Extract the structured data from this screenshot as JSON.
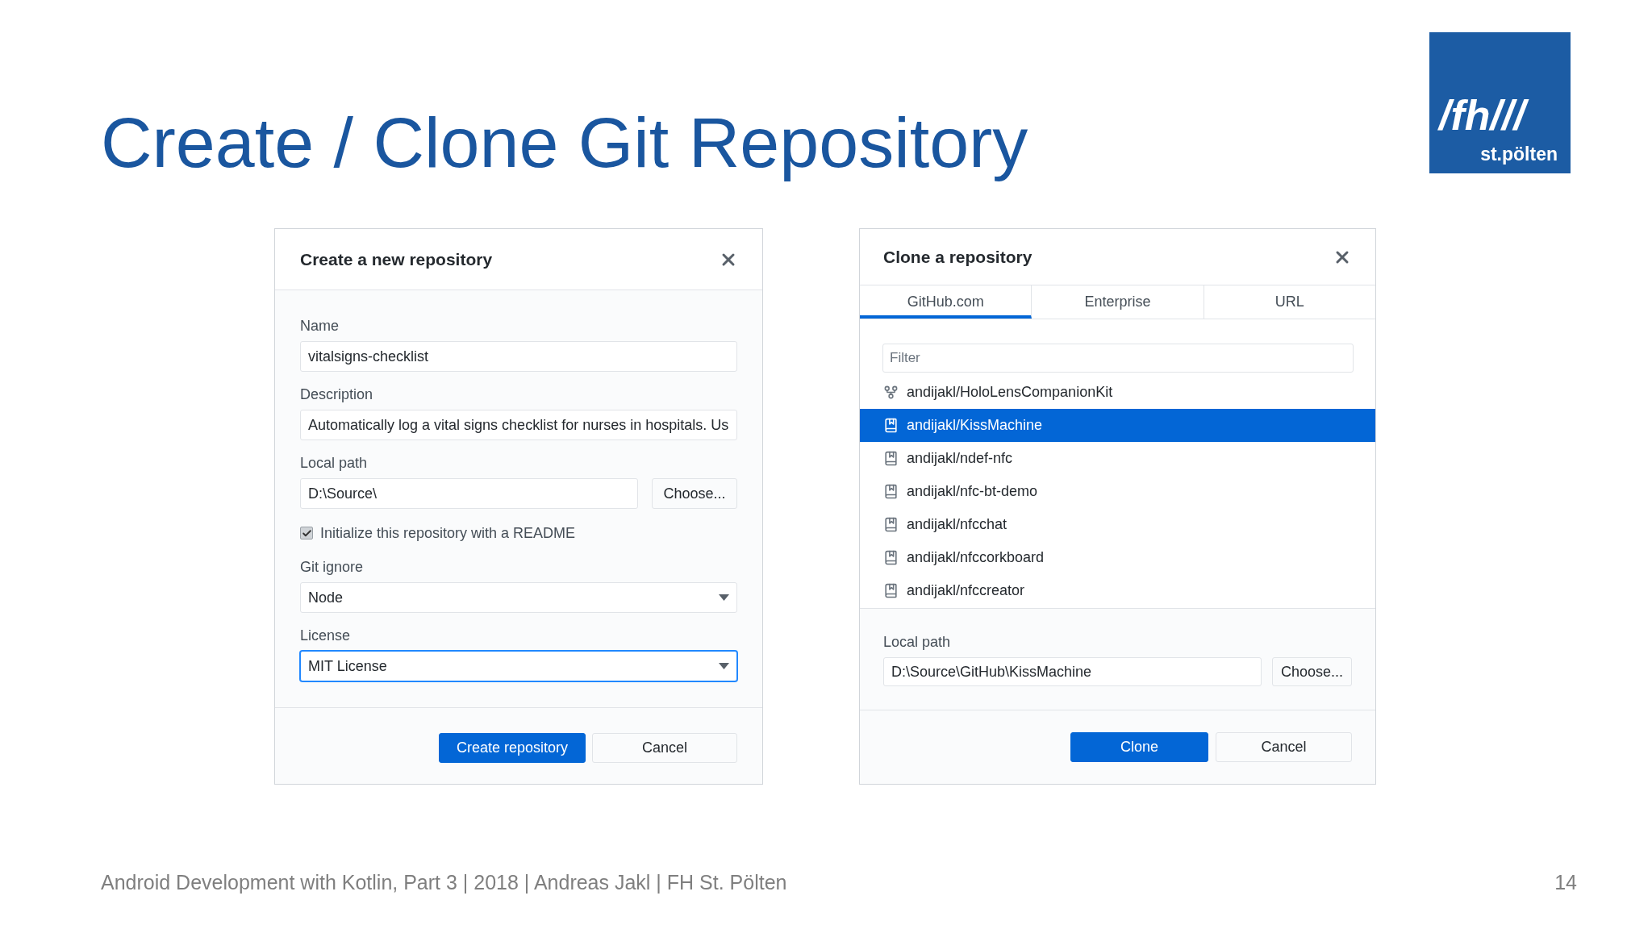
{
  "slide": {
    "title": "Create / Clone Git Repository",
    "footer": "Android Development with Kotlin, Part 3 | 2018 | Andreas Jakl | FH St. Pölten",
    "page_number": "14"
  },
  "logo": {
    "line_1": "/fh///",
    "line_2": "st.pölten"
  },
  "create_dialog": {
    "title": "Create a new repository",
    "fields": [
      {
        "kind": "text",
        "label": "Name",
        "value": "vitalsigns-checklist"
      },
      {
        "kind": "text",
        "label": "Description",
        "value": "Automatically log a vital signs checklist for nurses in hospitals. Us"
      },
      {
        "kind": "path",
        "label": "Local path",
        "value": "D:\\Source\\",
        "button": "Choose..."
      },
      {
        "kind": "checkbox",
        "label": "Initialize this repository with a README",
        "checked": true
      },
      {
        "kind": "select",
        "label": "Git ignore",
        "value": "Node",
        "focused": false
      },
      {
        "kind": "select",
        "label": "License",
        "value": "MIT License",
        "focused": true
      }
    ],
    "buttons": [
      {
        "label": "Create repository",
        "primary": true
      },
      {
        "label": "Cancel",
        "primary": false
      }
    ]
  },
  "clone_dialog": {
    "title": "Clone a repository",
    "tabs": [
      {
        "label": "GitHub.com",
        "selected": true
      },
      {
        "label": "Enterprise",
        "selected": false
      },
      {
        "label": "URL",
        "selected": false
      }
    ],
    "filter": {
      "placeholder": "Filter"
    },
    "repositories": [
      {
        "kind": "fork",
        "name": "andijakl/HoloLensCompanionKit",
        "selected": false
      },
      {
        "kind": "repo",
        "name": "andijakl/KissMachine",
        "selected": true
      },
      {
        "kind": "repo",
        "name": "andijakl/ndef-nfc",
        "selected": false
      },
      {
        "kind": "repo",
        "name": "andijakl/nfc-bt-demo",
        "selected": false
      },
      {
        "kind": "repo",
        "name": "andijakl/nfcchat",
        "selected": false
      },
      {
        "kind": "repo",
        "name": "andijakl/nfccorkboard",
        "selected": false
      },
      {
        "kind": "repo",
        "name": "andijakl/nfccreator",
        "selected": false
      }
    ],
    "local_path": {
      "label": "Local path",
      "value": "D:\\Source\\GitHub\\KissMachine",
      "button": "Choose..."
    },
    "buttons": [
      {
        "label": "Clone",
        "primary": true
      },
      {
        "label": "Cancel",
        "primary": false
      }
    ]
  }
}
